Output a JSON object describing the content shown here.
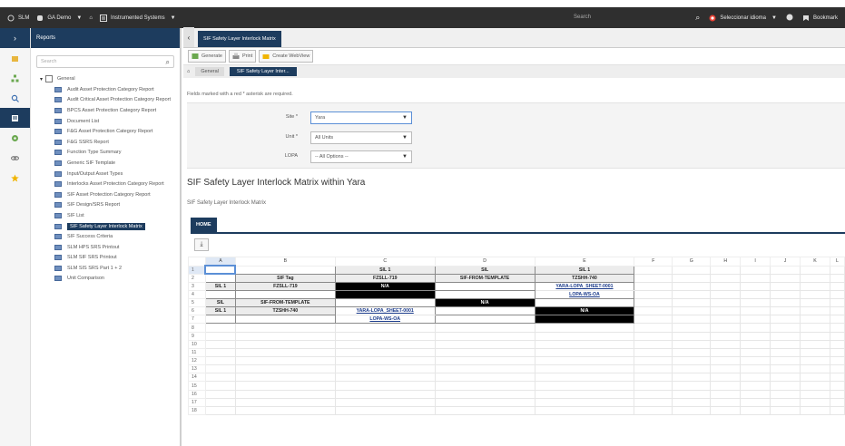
{
  "topbar": {
    "app": "SLM",
    "area": "GA Demo",
    "module": "Instrumented Systems",
    "search_placeholder": "Search",
    "language": "Seleccionar idioma",
    "bookmark": "Bookmark"
  },
  "nav": {
    "header": "Reports",
    "search_placeholder": "Search",
    "root_label": "General",
    "items": [
      "Audit Asset Protection Category Report",
      "Audit Critical Asset Protection Category Report",
      "BPCS Asset Protection Category Report",
      "Document List",
      "F&G Asset Protection Category Report",
      "F&G SSRS Report",
      "Function Type Summary",
      "Generic SIF Template",
      "Input/Output Asset Types",
      "Interlocks Asset Protection Category Report",
      "SIF Asset Protection Category Report",
      "SIF Design/SRS Report",
      "SIF List",
      "SIF Safety Layer Interlock Matrix",
      "SIF Success Criteria",
      "SLM HPS SRS Printout",
      "SLM SIF SRS Printout",
      "SLM SIS SRS Part 1 + 2",
      "Unit Comparison"
    ],
    "selected_index": 13
  },
  "main": {
    "tab": "SIF Safety Layer Interlock Matrix",
    "toolbar": {
      "generate": "Generate",
      "print": "Print",
      "create_webview": "Create WebView"
    },
    "breadcrumbs": [
      "General",
      "SIF Safety Layer Inter..."
    ],
    "required_note": "Fields marked with a red * asterisk are required.",
    "params": [
      {
        "label": "Site *",
        "value": "Yara"
      },
      {
        "label": "Unit *",
        "value": "All Units"
      },
      {
        "label": "LOPA",
        "value": "-- All Options --"
      }
    ],
    "report_title": "SIF Safety Layer Interlock Matrix within Yara",
    "report_subtitle": "SIF Safety Layer Interlock Matrix",
    "home_tab": "HOME"
  },
  "sheet": {
    "columns": [
      "A",
      "B",
      "C",
      "D",
      "E",
      "F",
      "G",
      "H",
      "I",
      "J",
      "K",
      "L"
    ],
    "row_numbers": [
      "1",
      "2",
      "3",
      "4",
      "5",
      "6",
      "7",
      "8",
      "9",
      "10",
      "11",
      "12",
      "13",
      "14",
      "15",
      "16",
      "17",
      "18"
    ],
    "r1": {
      "c": "SIL 1",
      "d": "SIL",
      "e": "SIL 1"
    },
    "r2": {
      "b": "SIF Tag",
      "c": "FZSLL-719",
      "d": "SIF-FROM-TEMPLATE",
      "e": "TZSHH-740"
    },
    "r3": {
      "a": "SIL 1",
      "b": "FZSLL-719",
      "c": "N/A",
      "e": "YARA-LOPA_SHEET-0001"
    },
    "r4": {
      "e": "LOPA-WS-OA"
    },
    "r5": {
      "a": "SIL",
      "b": "SIF-FROM-TEMPLATE",
      "d": "N/A"
    },
    "r6": {
      "a": "SIL 1",
      "b": "TZSHH-740",
      "c": "YARA-LOPA_SHEET-0001",
      "e": "N/A"
    },
    "r7": {
      "c": "LOPA-WS-OA"
    }
  }
}
